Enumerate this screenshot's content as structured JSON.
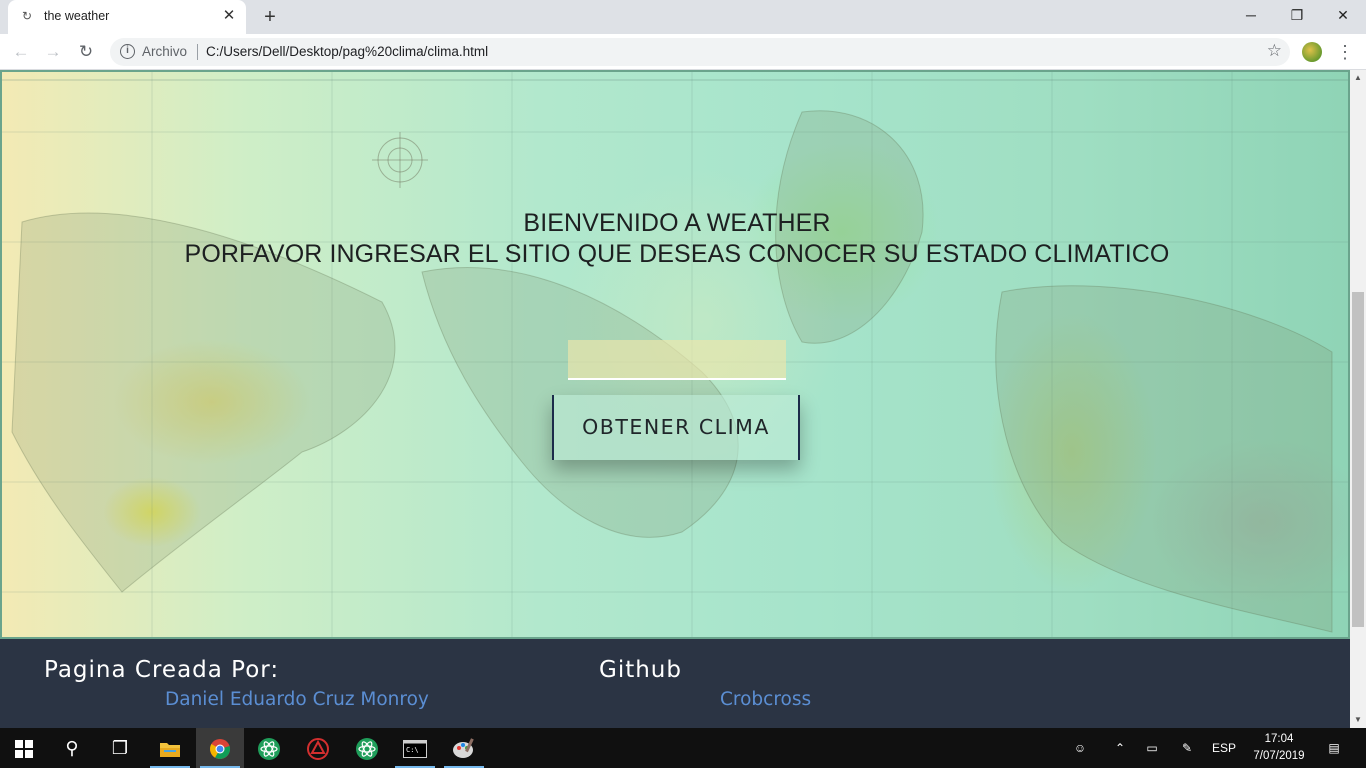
{
  "tab": {
    "title": "the weather",
    "favicon": "loading-icon"
  },
  "toolbar": {
    "scheme": "Archivo",
    "url": "C:/Users/Dell/Desktop/pag%20clima/clima.html"
  },
  "page": {
    "heading_line1": "BIENVENIDO A WEATHER",
    "heading_line2": "PORFAVOR INGRESAR EL SITIO QUE DESEAS CONOCER SU ESTADO CLIMATICO",
    "city_input_value": "",
    "button_label": "OBTENER CLIMA"
  },
  "footer": {
    "created_by_label": "Pagina Creada Por:",
    "author": "Daniel Eduardo Cruz Monroy",
    "github_label": "Github",
    "github_user": "Crobcross"
  },
  "taskbar": {
    "language": "ESP",
    "time": "17:04",
    "date": "7/07/2019"
  },
  "colors": {
    "footer_bg": "#2b3444",
    "footer_link": "#5b8ed3",
    "button_border": "#1c2b4a"
  }
}
